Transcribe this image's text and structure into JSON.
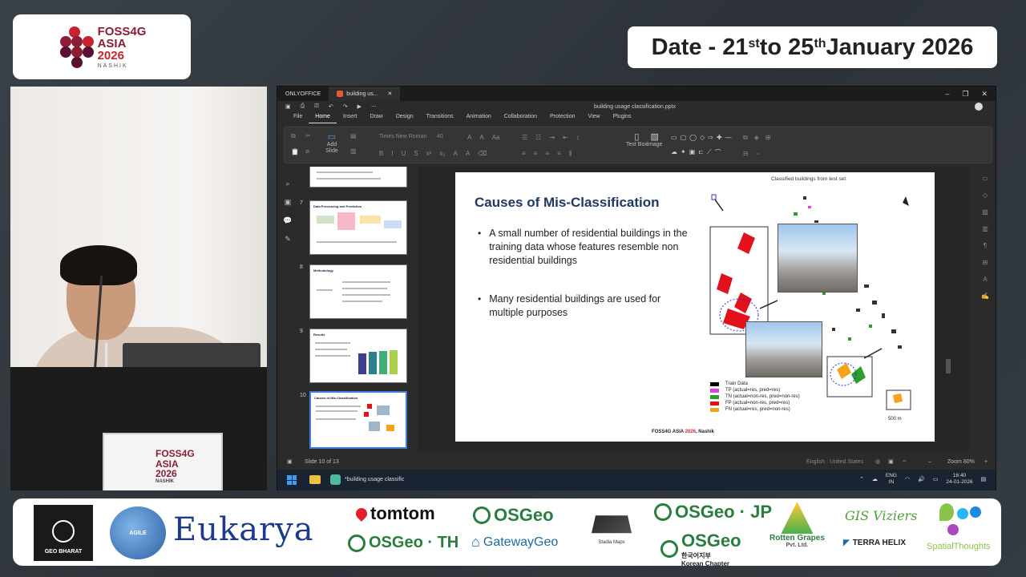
{
  "event": {
    "logo_lines": [
      "FOSS4G",
      "ASIA",
      "2026",
      "NASHIK"
    ],
    "date_prefix": "Date - 21",
    "date_sup1": "st",
    "date_mid": " to 25",
    "date_sup2": "th",
    "date_suffix": " January 2026"
  },
  "video": {
    "sign_lines": [
      "FOSS4G",
      "ASIA",
      "2026",
      "NASHIK"
    ]
  },
  "app": {
    "tab_app": "ONLYOFFICE",
    "tab_doc": "building us...",
    "file_title": "building usage classification.pptx",
    "menu": [
      "File",
      "Home",
      "Insert",
      "Draw",
      "Design",
      "Transitions",
      "Animation",
      "Collaboration",
      "Protection",
      "View",
      "Plugins"
    ],
    "menu_active": "Home",
    "font_name": "Times New Roman",
    "font_size": "40",
    "add_slide": "Add Slide",
    "text_box": "Text Box",
    "image": "Image"
  },
  "thumbnails": [
    {
      "num": "7",
      "title": "Data Processing and Prediction"
    },
    {
      "num": "8",
      "title": "Methodology"
    },
    {
      "num": "9",
      "title": "Results"
    },
    {
      "num": "10",
      "title": "Causes of Mis-Classification"
    }
  ],
  "slide": {
    "title": "Causes of Mis-Classification",
    "bullets": [
      "A small number of residential buildings in the training data whose features resemble non residential buildings",
      "Many residential buildings are used for multiple purposes"
    ],
    "figure_caption": "Classified buildings from test set",
    "legend": [
      {
        "label": "Train Data",
        "color": "#000000"
      },
      {
        "label": "TP (actual=res, pred=res)",
        "color": "#e040e0"
      },
      {
        "label": "TN (actual=non-res, pred=non-res)",
        "color": "#2aa02a"
      },
      {
        "label": "FP (actual=non-res, pred=res)",
        "color": "#e3111c"
      },
      {
        "label": "FN (actual=res, pred=non-res)",
        "color": "#f2a51a"
      }
    ],
    "scale_label": "500 m",
    "footer_prefix": "FOSS4G ASIA ",
    "footer_year": "2026",
    "footer_suffix": ", Nashik"
  },
  "status": {
    "slide_info": "Slide 10 of 13",
    "language": "English · United States",
    "zoom": "Zoom 80%"
  },
  "taskbar": {
    "window_title": "*building usage classific",
    "lang_line1": "ENG",
    "lang_line2": "IN",
    "time": "16:40",
    "date": "24-01-2026"
  },
  "sponsors": {
    "geo_bharat": "GEO BHARAT",
    "agile": "AGILE",
    "eukarya": "Eukarya",
    "tomtom": "tomtom",
    "osgeo": "OSGeo",
    "osgeo_th": "OSGeo · TH",
    "gateway": "GatewayGeo",
    "stadia": "Stadia Maps",
    "osgeo_jp": "OSGeo · JP",
    "osgeo_kr": "OSGeo",
    "korea_line1": "한국어지부",
    "korea_line2": "Korean Chapter",
    "rotten": "Rotten Grapes",
    "rotten_sub": "Pvt. Ltd.",
    "gis": "GIS Viziers",
    "terra": "TERRA HELIX",
    "spatial": "SpatialThoughts"
  }
}
